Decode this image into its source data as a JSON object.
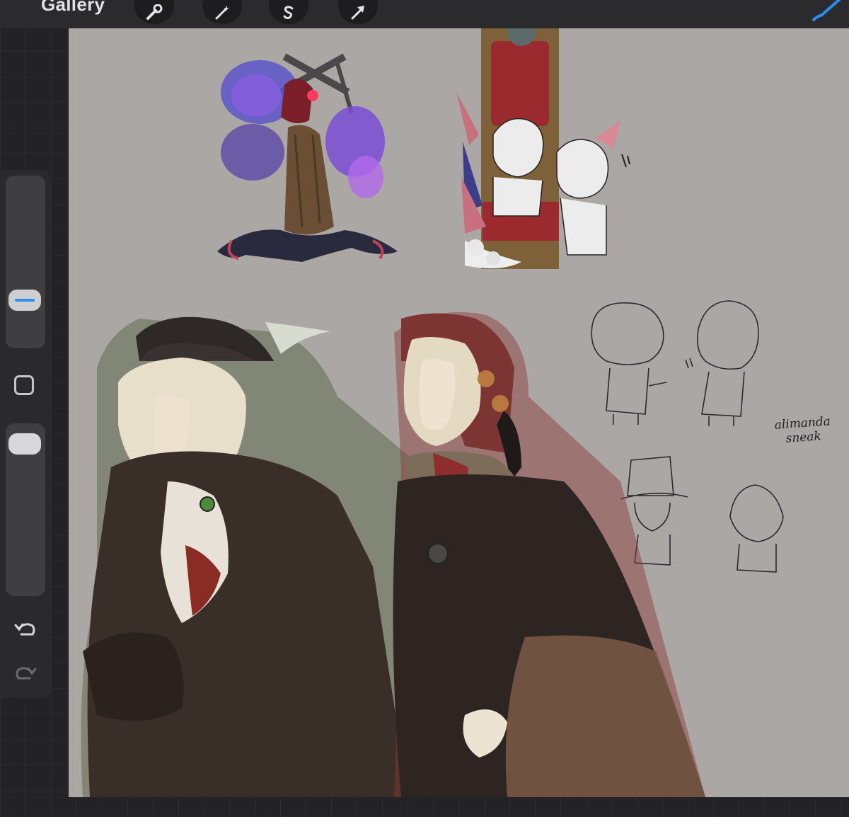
{
  "toolbar": {
    "gallery_label": "Gallery",
    "tools": [
      {
        "name": "wrench-icon"
      },
      {
        "name": "magic-wand-icon"
      },
      {
        "name": "selection-s-icon"
      },
      {
        "name": "arrow-cursor-icon"
      }
    ],
    "active_tool_icon": "brush-icon",
    "accent_color": "#2c8cf0"
  },
  "sidebar": {
    "brush_size_level": 0.24,
    "opacity_level": 0.95,
    "modify_icon": "square-icon",
    "undo_icon": "undo-icon",
    "redo_icon": "redo-icon"
  },
  "canvas": {
    "background_color": "#aba7a5",
    "signature": {
      "line1": "alimanda",
      "line2": "sneak"
    }
  }
}
